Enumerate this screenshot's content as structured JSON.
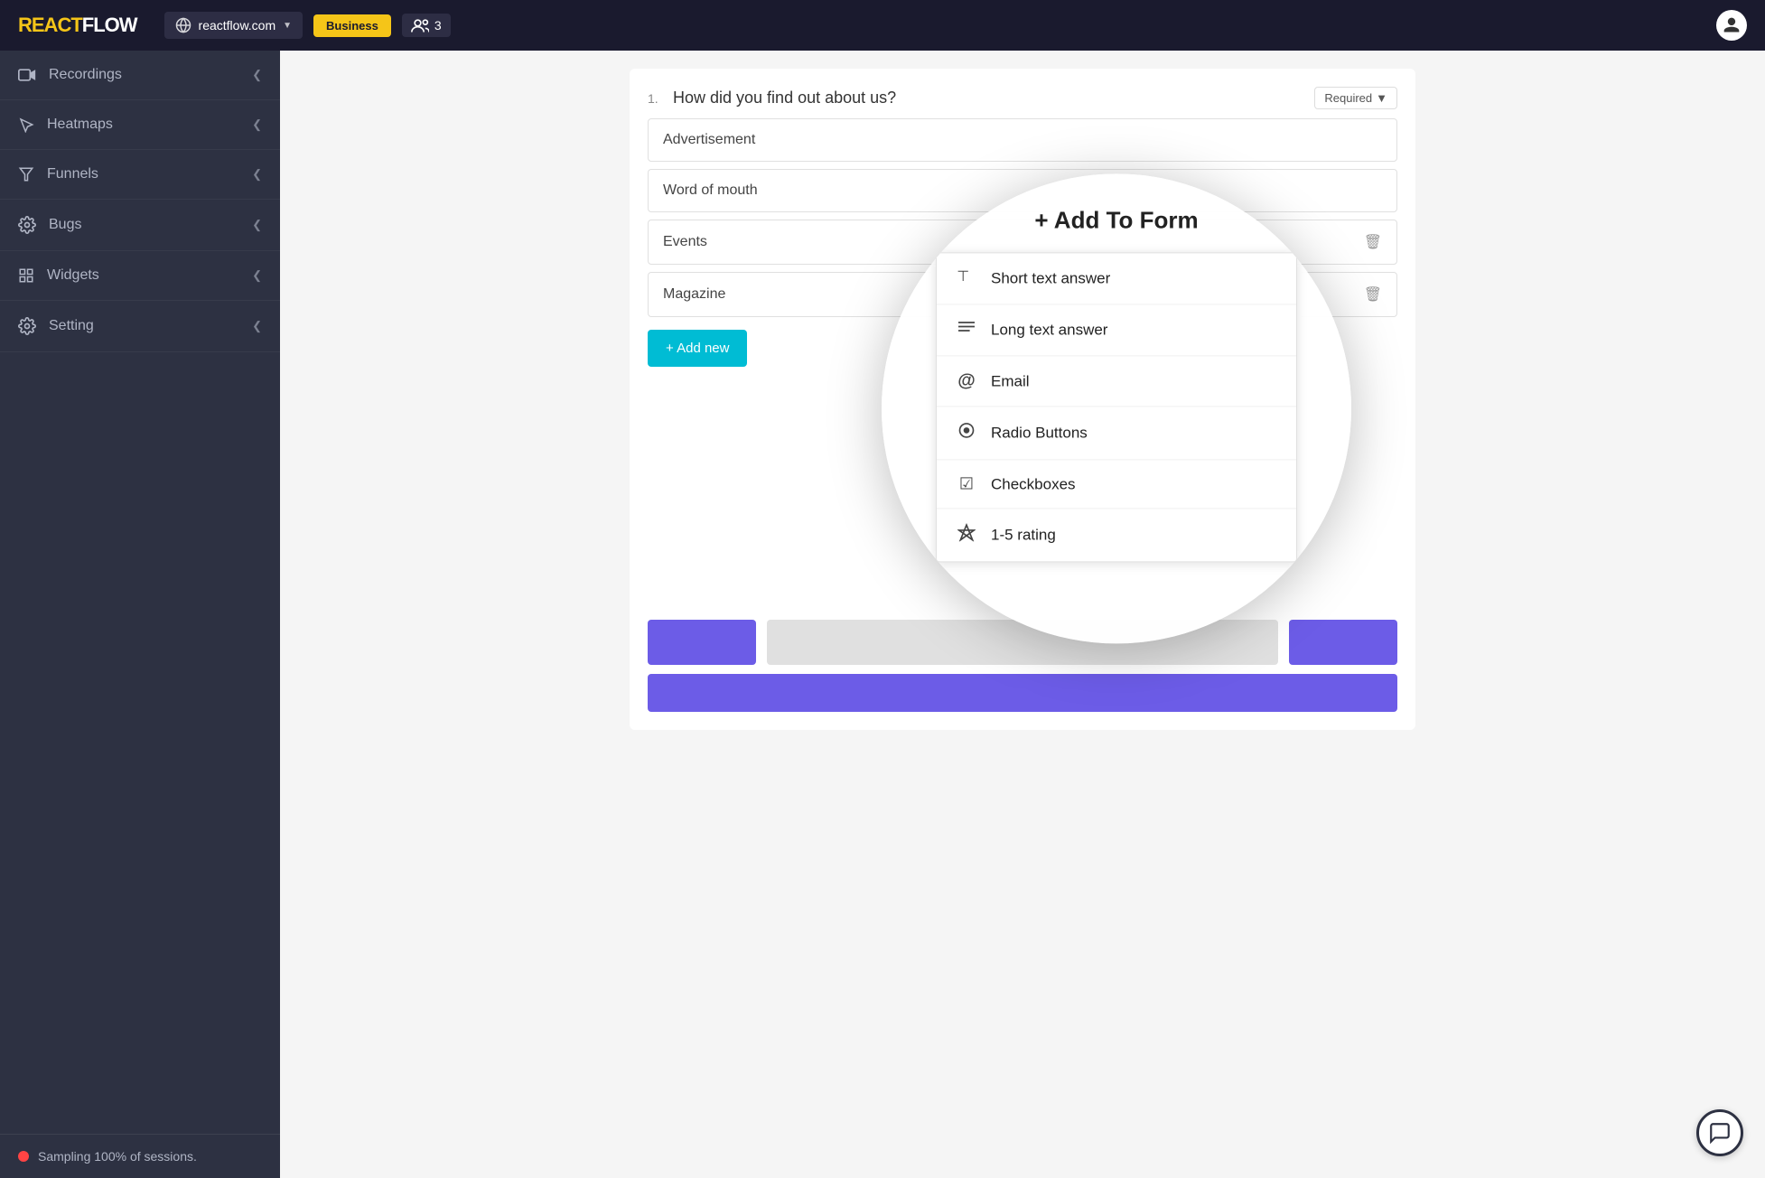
{
  "header": {
    "logo_react": "REACT",
    "logo_flow": "FLOW",
    "site_name": "reactflow.com",
    "plan_label": "Business",
    "team_count": "3"
  },
  "sidebar": {
    "items": [
      {
        "id": "recordings",
        "label": "Recordings",
        "icon": "video"
      },
      {
        "id": "heatmaps",
        "label": "Heatmaps",
        "icon": "cursor"
      },
      {
        "id": "funnels",
        "label": "Funnels",
        "icon": "funnel"
      },
      {
        "id": "bugs",
        "label": "Bugs",
        "icon": "gear"
      },
      {
        "id": "widgets",
        "label": "Widgets",
        "icon": "grid"
      },
      {
        "id": "setting",
        "label": "Setting",
        "icon": "settings"
      }
    ],
    "sampling_label": "Sampling 100% of sessions."
  },
  "form": {
    "question_num": "1.",
    "question_text": "How did you find out about us?",
    "required_label": "Required",
    "options": [
      {
        "text": "Advertisement",
        "deletable": false
      },
      {
        "text": "Word of mouth",
        "deletable": false
      },
      {
        "text": "Events",
        "deletable": true
      },
      {
        "text": "Magazine",
        "deletable": true
      }
    ],
    "add_new_label": "+ Add new",
    "add_to_form_title": "+ Add To Form"
  },
  "dropdown": {
    "items": [
      {
        "id": "short-text",
        "icon": "⊤",
        "label": "Short text answer"
      },
      {
        "id": "long-text",
        "icon": "≡",
        "label": "Long text answer"
      },
      {
        "id": "email",
        "icon": "@",
        "label": "Email"
      },
      {
        "id": "radio",
        "icon": "◎",
        "label": "Radio Buttons"
      },
      {
        "id": "checkboxes",
        "icon": "☑",
        "label": "Checkboxes"
      },
      {
        "id": "rating",
        "icon": "⚑",
        "label": "1-5 rating"
      }
    ]
  },
  "footer": {
    "messenger_icon": "💬"
  }
}
